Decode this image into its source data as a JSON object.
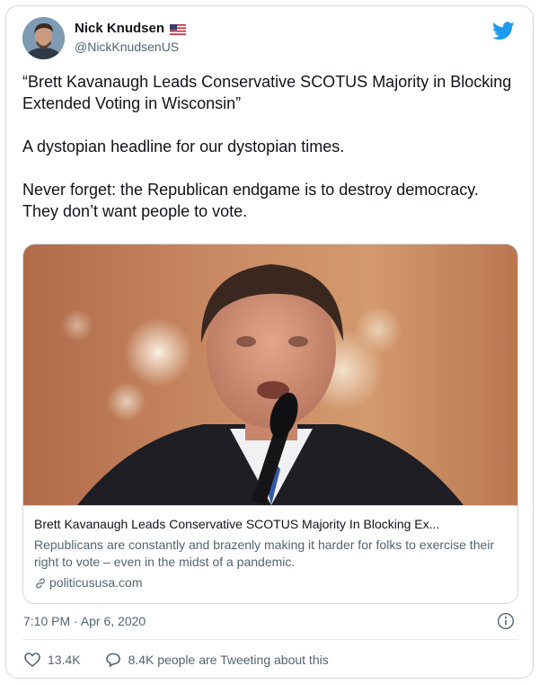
{
  "author": {
    "name": "Nick Knudsen",
    "handle": "@NickKnudsenUS",
    "flag_icon": "us-flag-icon"
  },
  "tweet": {
    "paragraphs": [
      "“Brett Kavanaugh Leads Conservative SCOTUS Majority in Blocking Extended Voting in Wisconsin”",
      "A dystopian headline for our dystopian times.",
      "Never forget: the Republican endgame is to destroy democracy. They don’t want people to vote."
    ]
  },
  "link_card": {
    "image_icon": "article-photo",
    "title": "Brett Kavanaugh Leads Conservative SCOTUS Majority In Blocking Ex...",
    "description": "Republicans are constantly and brazenly making it harder for folks to exercise their right to vote – even in the midst of a pandemic.",
    "domain": "politicususa.com"
  },
  "meta": {
    "timestamp": "7:10 PM · Apr 6, 2020"
  },
  "actions": {
    "likes": "13.4K",
    "tweeting_about": "8.4K people are Tweeting about this"
  },
  "colors": {
    "twitter_blue": "#1d9bf0",
    "secondary_text": "#536471",
    "border": "#cfd9de"
  }
}
